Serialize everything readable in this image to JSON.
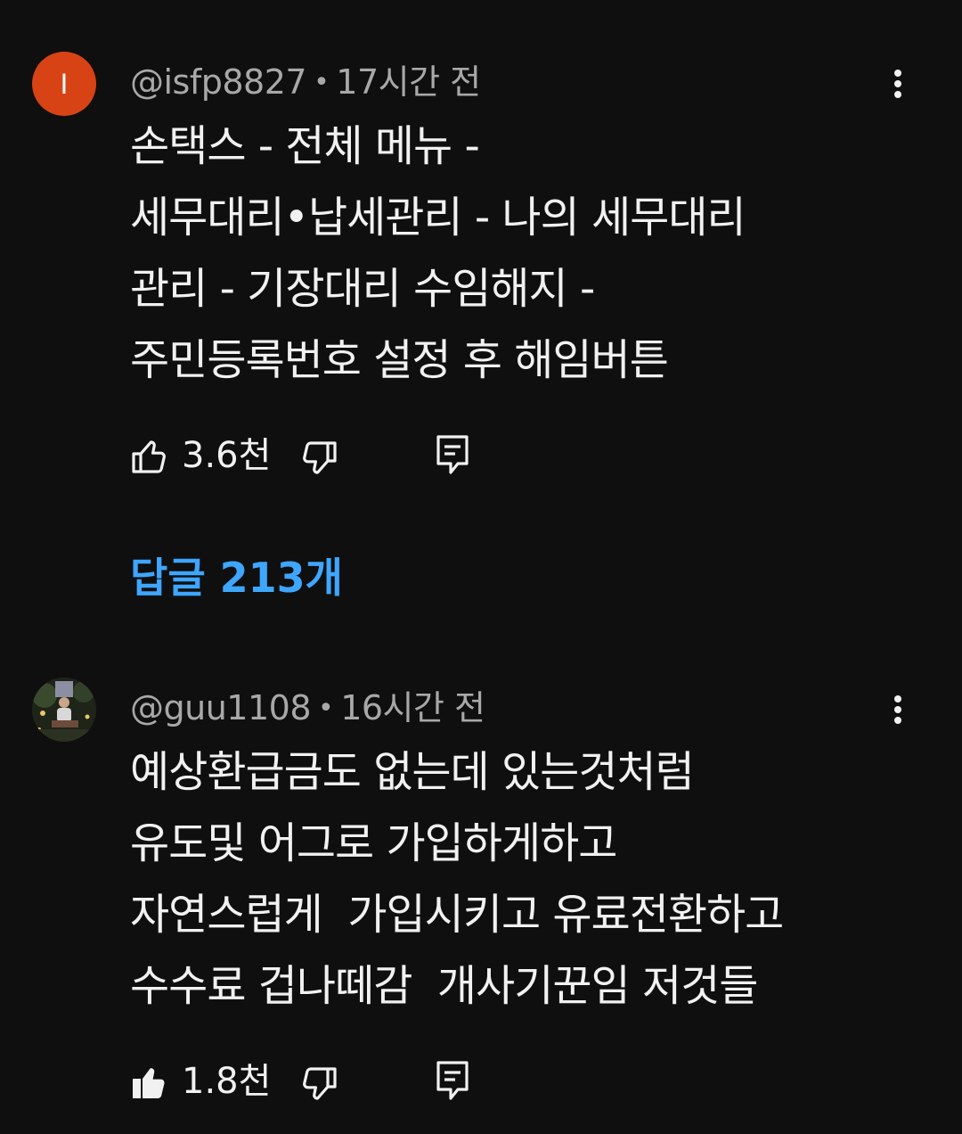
{
  "comments": [
    {
      "avatar_letter": "I",
      "avatar_color": "#d84315",
      "handle": "@isfp8827",
      "separator": "•",
      "time": "17시간 전",
      "lines": [
        "손택스 - 전체 메뉴 -",
        "세무대리•납세관리 - 나의 세무대리",
        "관리 - 기장대리 수임해지 -",
        "주민등록번호 설정 후 해임버튼"
      ],
      "likes": "3.6천",
      "liked": false,
      "replies_label": "답글 213개"
    },
    {
      "avatar_icon": "profile-photo-avatar",
      "handle": "@guu1108",
      "separator": "•",
      "time": "16시간 전",
      "lines": [
        "예상환급금도 없는데 있는것처럼",
        "유도및 어그로 가입하게하고",
        "자연스럽게  가입시키고 유료전환하고",
        "수수료 겁나떼감  개사기꾼임 저것들"
      ],
      "likes": "1.8천",
      "liked": true
    }
  ],
  "colors": {
    "background": "#0f0f0f",
    "text": "#f1f1f1",
    "meta": "#a8a8a8",
    "link": "#3ea6ff"
  },
  "icons": {
    "like": "thumbs-up-icon",
    "dislike": "thumbs-down-icon",
    "reply": "reply-comment-icon",
    "more": "more-vertical-icon"
  }
}
